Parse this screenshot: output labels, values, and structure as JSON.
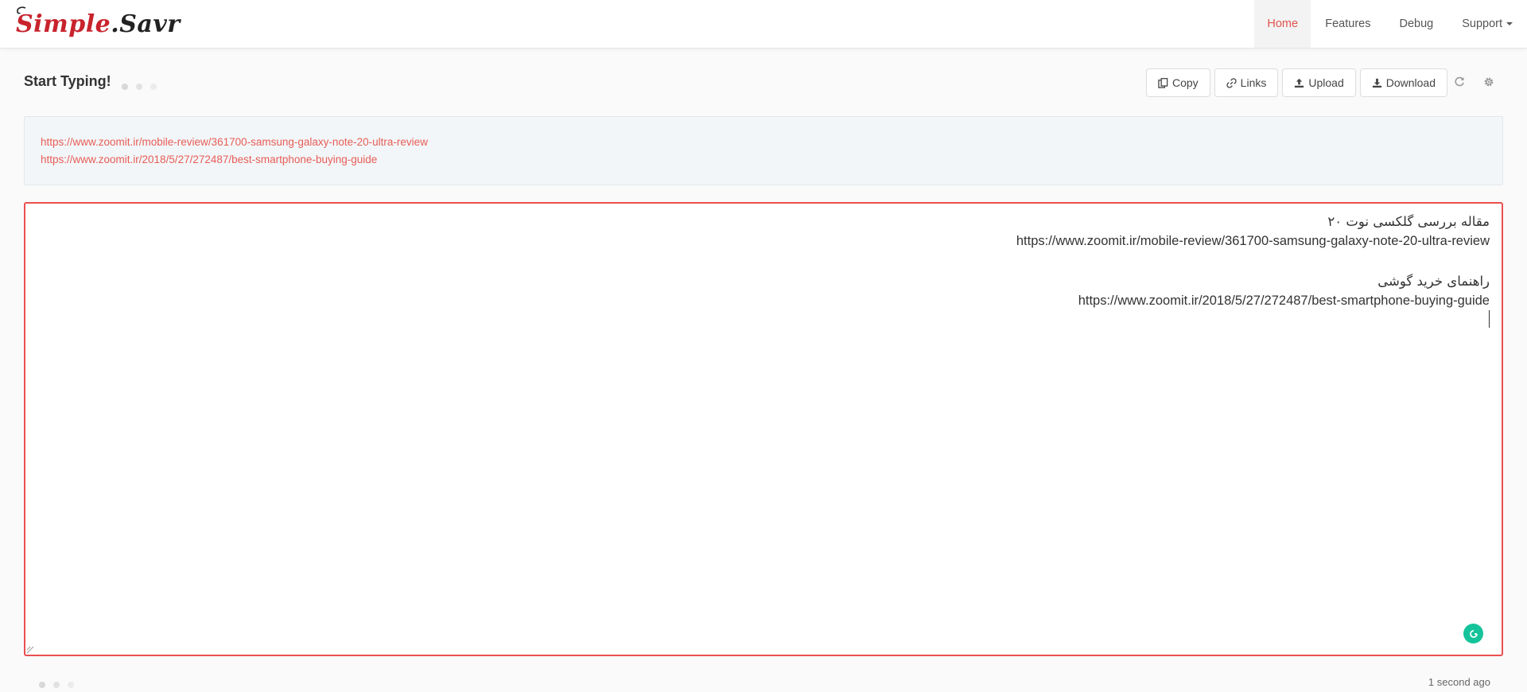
{
  "brand": {
    "logo_text_red": "Simple",
    "logo_text_dark": ".Savr"
  },
  "nav": {
    "items": [
      {
        "label": "Home",
        "active": true
      },
      {
        "label": "Features",
        "active": false
      },
      {
        "label": "Debug",
        "active": false
      },
      {
        "label": "Support",
        "active": false
      }
    ]
  },
  "page": {
    "title": "Start Typing!"
  },
  "toolbar": {
    "copy_label": "Copy",
    "links_label": "Links",
    "upload_label": "Upload",
    "download_label": "Download",
    "icons": [
      "copy-icon",
      "link-icon",
      "upload-icon",
      "download-icon",
      "refresh-icon",
      "gear-icon"
    ]
  },
  "links": [
    "https://www.zoomit.ir/mobile-review/361700-samsung-galaxy-note-20-ultra-review",
    "https://www.zoomit.ir/2018/5/27/272487/best-smartphone-buying-guide"
  ],
  "editor": {
    "line1": "مقاله بررسی گلکسی نوت ۲۰",
    "line2": "https://www.zoomit.ir/mobile-review/361700-samsung-galaxy-note-20-ultra-review",
    "line3": "",
    "line4": "راهنمای خرید گوشی",
    "line5": "https://www.zoomit.ir/2018/5/27/272487/best-smartphone-buying-guide"
  },
  "status": {
    "saved_time": "1 second ago"
  },
  "colors": {
    "accent": "#e85d57",
    "editor_border": "#ea4f4f",
    "grammarly": "#15c39a",
    "brand_red": "#c8232c"
  }
}
